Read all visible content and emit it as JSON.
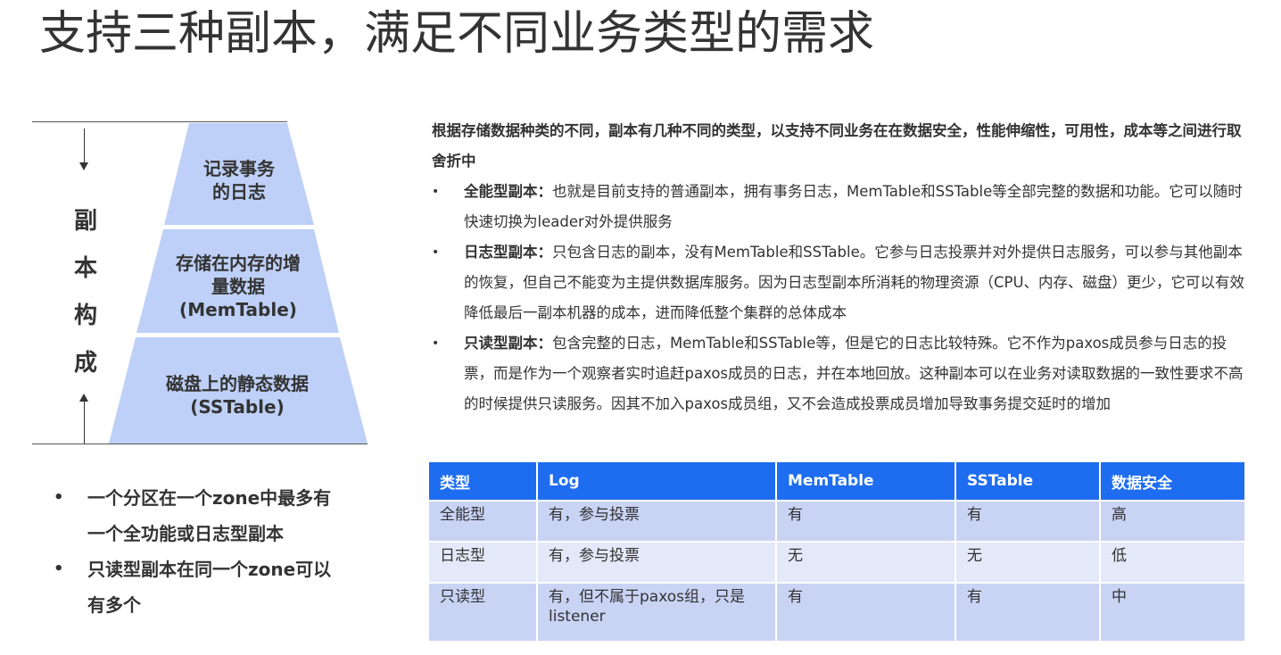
{
  "title": "支持三种副本，满足不同业务类型的需求",
  "diagram": {
    "side_label": [
      "副",
      "本",
      "构",
      "成"
    ],
    "layers": [
      {
        "text_lines": [
          "记录事务",
          "的日志"
        ]
      },
      {
        "text_lines": [
          "存储在内存的增",
          "量数据",
          "(MemTable)"
        ]
      },
      {
        "text_lines": [
          "磁盘上的静态数据",
          "(SSTable)"
        ]
      }
    ],
    "fill_color": "#bed0f7"
  },
  "left_bullets": [
    {
      "bullet": "•",
      "lines": [
        "一个分区在一个zone中最多有",
        "一个全功能或日志型副本"
      ]
    },
    {
      "bullet": "•",
      "lines": [
        "只读型副本在同一个zone可以",
        "有多个"
      ]
    }
  ],
  "intro": "根据存储数据种类的不同，副本有几种不同的类型，以支持不同业务在在数据安全，性能伸缩性，可用性，成本等之间进行取舍折中",
  "bullets": [
    {
      "bullet": "•",
      "lead": "全能型副本：",
      "text": "也就是目前支持的普通副本，拥有事务日志，MemTable和SSTable等全部完整的数据和功能。它可以随时快速切换为leader对外提供服务"
    },
    {
      "bullet": "•",
      "lead": "日志型副本：",
      "text": "只包含日志的副本，没有MemTable和SSTable。它参与日志投票并对外提供日志服务，可以参与其他副本的恢复，但自己不能变为主提供数据库服务。因为日志型副本所消耗的物理资源（CPU、内存、磁盘）更少，它可以有效降低最后一副本机器的成本，进而降低整个集群的总体成本"
    },
    {
      "bullet": "•",
      "lead": "只读型副本：",
      "text": "包含完整的日志，MemTable和SSTable等，但是它的日志比较特殊。它不作为paxos成员参与日志的投票，而是作为一个观察者实时追赶paxos成员的日志，并在本地回放。这种副本可以在业务对读取数据的一致性要求不高的时候提供只读服务。因其不加入paxos成员组，又不会造成投票成员增加导致事务提交延时的增加"
    }
  ],
  "table": {
    "header_color": "#1e6df0",
    "headers": [
      "类型",
      "Log",
      "MemTable",
      "SSTable",
      "数据安全"
    ],
    "rows": [
      [
        "全能型",
        "有，参与投票",
        "有",
        "有",
        "高"
      ],
      [
        "日志型",
        "有，参与投票",
        "无",
        "无",
        "低"
      ],
      [
        "只读型",
        "有，但不属于paxos组，只是listener",
        "有",
        "有",
        "中"
      ]
    ]
  }
}
